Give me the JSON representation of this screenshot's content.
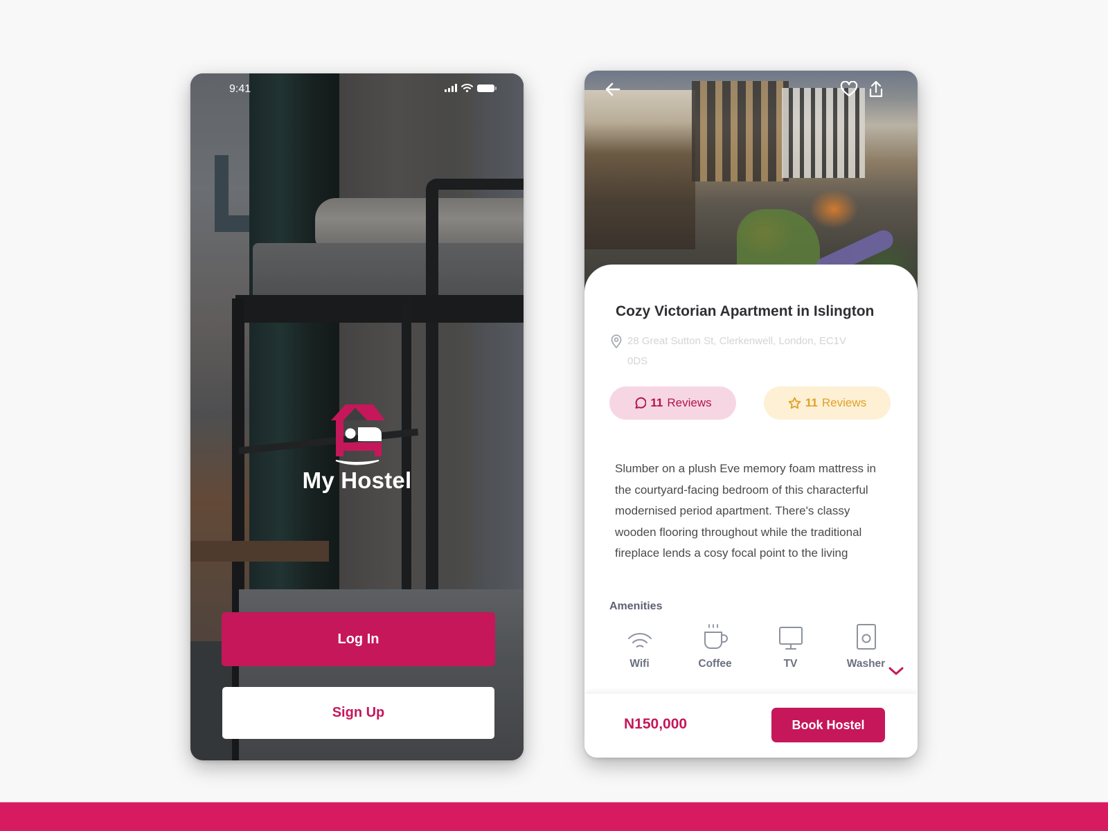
{
  "colors": {
    "brand_primary": "#c5175a",
    "band": "#d81b60",
    "review_pill_bg": "#f7d6e3",
    "rating_pill_bg": "#fdf0d4",
    "rating_accent": "#e0a12a"
  },
  "welcome_screen": {
    "status_bar": {
      "time": "9:41",
      "icons": [
        "signal-icon",
        "wifi-icon",
        "battery-icon"
      ]
    },
    "brand": {
      "logo": "house-bed-logo-icon",
      "name": "My Hostel"
    },
    "buttons": {
      "login": "Log In",
      "signup": "Sign Up"
    }
  },
  "detail_screen": {
    "top_bar": {
      "back_icon": "arrow-left-icon",
      "favorite_icon": "heart-icon",
      "share_icon": "share-icon"
    },
    "title": "Cozy Victorian Apartment in Islington",
    "address": "28 Great Sutton St, Clerkenwell, London, EC1V 0DS",
    "reviews": {
      "comments": {
        "count": "11",
        "label": "Reviews",
        "icon": "comment-icon"
      },
      "ratings": {
        "count": "11",
        "label": "Reviews",
        "icon": "star-icon"
      }
    },
    "description": "Slumber on a plush Eve memory foam mattress in the courtyard-facing bedroom of this characterful modernised period apartment. There's classy wooden flooring throughout while the traditional fireplace lends a cosy focal point to the living",
    "amenities": {
      "label": "Amenities",
      "items": [
        {
          "label": "Wifi",
          "icon": "wifi-icon"
        },
        {
          "label": "Coffee",
          "icon": "coffee-cup-icon"
        },
        {
          "label": "TV",
          "icon": "monitor-icon"
        },
        {
          "label": "Washer",
          "icon": "washer-icon"
        }
      ],
      "expand_icon": "chevron-down-icon"
    },
    "footer": {
      "price": "N150,000",
      "book_label": "Book Hostel"
    }
  }
}
